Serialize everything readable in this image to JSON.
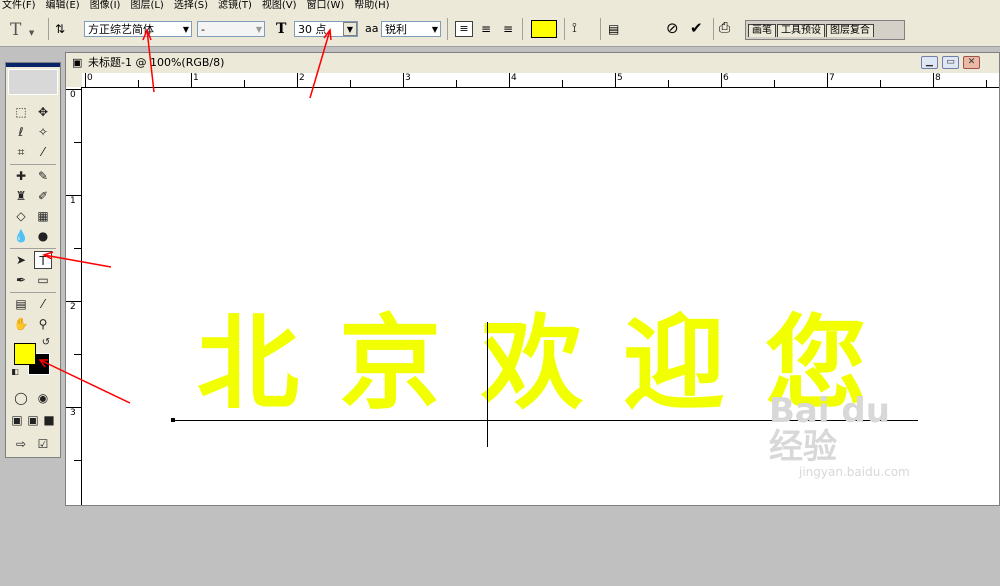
{
  "menu": {
    "items": [
      "文件(F)",
      "编辑(E)",
      "图像(I)",
      "图层(L)",
      "选择(S)",
      "滤镜(T)",
      "视图(V)",
      "窗口(W)",
      "帮助(H)"
    ]
  },
  "options_bar": {
    "tool_glyph": "T",
    "font_family": "方正综艺简体",
    "font_style": "-",
    "font_size": "30 点",
    "antialias_label": "aa",
    "antialias": "锐利",
    "text_color": "#ffff00",
    "palette_tabs": [
      "画笔",
      "工具预设",
      "图层复合"
    ]
  },
  "document": {
    "title": "未标题-1 @ 100%(RGB/8)",
    "ruler_top_numbers": [
      "0",
      "1",
      "2",
      "3",
      "4",
      "5",
      "6",
      "7",
      "8"
    ],
    "ruler_left_numbers": [
      "0",
      "1",
      "2",
      "3"
    ],
    "text_chars": [
      "北",
      "京",
      "欢",
      "迎",
      "您"
    ],
    "text_color": "#f2ff00"
  },
  "toolbox": {
    "foreground_color": "#ffff00",
    "background_color": "#000000",
    "active_tool": "type-tool"
  },
  "watermark": {
    "logo": "Bai du 经验",
    "url": "jingyan.baidu.com"
  },
  "annotation_color": "#ff0000"
}
